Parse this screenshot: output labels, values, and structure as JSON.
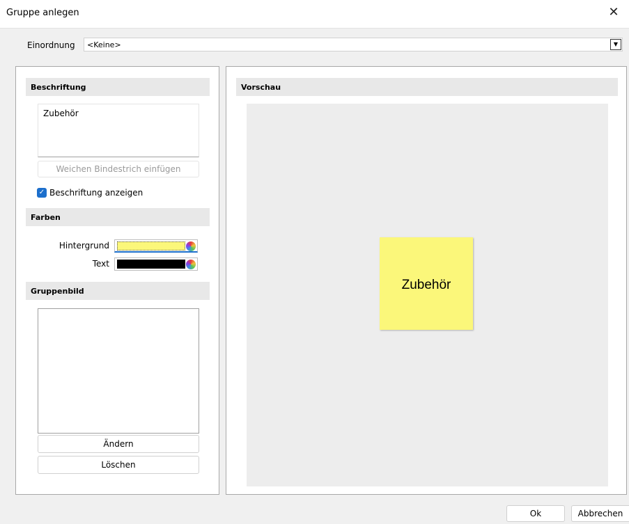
{
  "window": {
    "title": "Gruppe anlegen",
    "close_icon": "close-icon"
  },
  "einordnung": {
    "label": "Einordnung",
    "value": "<Keine>"
  },
  "left": {
    "beschriftung": {
      "header": "Beschriftung",
      "text": "Zubehör",
      "hyphen_button": "Weichen Bindestrich einfügen",
      "checkbox_label": "Beschriftung anzeigen",
      "checkbox_checked": true
    },
    "farben": {
      "header": "Farben",
      "background_label": "Hintergrund",
      "background_color": "#fbf77a",
      "text_label": "Text",
      "text_color": "#000000"
    },
    "gruppenbild": {
      "header": "Gruppenbild",
      "change_button": "Ändern",
      "delete_button": "Löschen"
    }
  },
  "preview": {
    "header": "Vorschau",
    "sticky_text": "Zubehör"
  },
  "footer": {
    "ok_button": "Ok",
    "cancel_button": "Abbrechen"
  }
}
